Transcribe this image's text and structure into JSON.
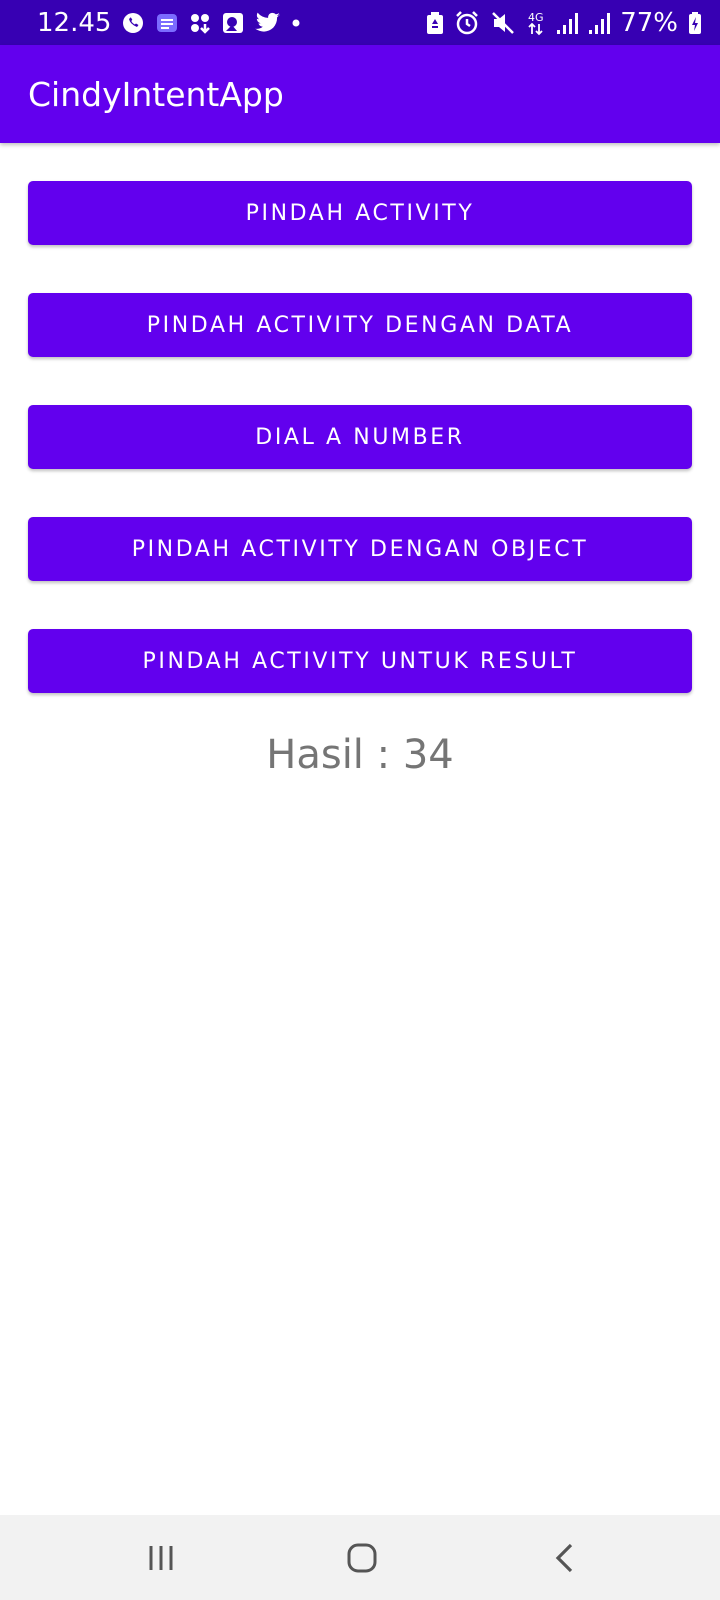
{
  "status_bar": {
    "time": "12.45",
    "battery_percent": "77%",
    "left_icons": [
      "whatsapp-icon",
      "messages-icon",
      "apps-grid-icon",
      "gallery-icon",
      "twitter-icon",
      "dot-icon"
    ],
    "right_icons": [
      "battery-saver-icon",
      "alarm-icon",
      "mute-icon",
      "4g-data-icon",
      "signal-icon",
      "signal-icon",
      "battery-icon"
    ],
    "network_label": "4G"
  },
  "app_bar": {
    "title": "CindyIntentApp"
  },
  "buttons": [
    {
      "label": "PINDAH ACTIVITY"
    },
    {
      "label": "PINDAH ACTIVITY DENGAN DATA"
    },
    {
      "label": "DIAL A NUMBER"
    },
    {
      "label": "PINDAH ACTIVITY DENGAN OBJECT"
    },
    {
      "label": "PINDAH ACTIVITY UNTUK RESULT"
    }
  ],
  "result_text": "Hasil : 34",
  "nav_bar": {
    "icons": [
      "recents-icon",
      "home-icon",
      "back-icon"
    ]
  },
  "colors": {
    "status_bar": "#3700b3",
    "primary": "#6200ee",
    "result_text": "#757575",
    "nav_bar": "#f2f2f2"
  }
}
